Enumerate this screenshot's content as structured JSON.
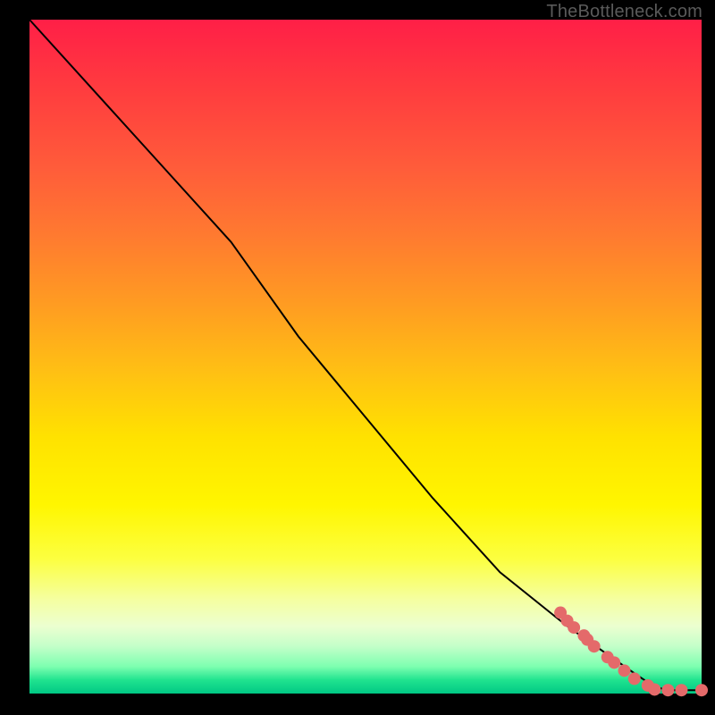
{
  "attribution": "TheBottleneck.com",
  "palette": {
    "line": "#000000",
    "marker": "#e46a6a",
    "marker_stroke": "#d85a5a"
  },
  "chart_data": {
    "type": "line",
    "title": "",
    "xlabel": "",
    "ylabel": "",
    "xlim": [
      0,
      100
    ],
    "ylim": [
      0,
      100
    ],
    "grid": false,
    "legend": false,
    "series": [
      {
        "name": "curve",
        "kind": "line",
        "x": [
          0,
          10,
          20,
          30,
          40,
          50,
          60,
          70,
          80,
          90,
          93,
          95,
          97,
          100
        ],
        "y": [
          100,
          89,
          78,
          67,
          53,
          41,
          29,
          18,
          10,
          3,
          1,
          0.5,
          0.5,
          0.5
        ]
      },
      {
        "name": "markers",
        "kind": "scatter",
        "x": [
          79,
          80,
          81,
          82.5,
          83,
          84,
          86,
          87,
          88.5,
          90,
          92,
          93,
          95,
          97,
          100
        ],
        "y": [
          12.0,
          10.8,
          9.8,
          8.6,
          8.0,
          7.0,
          5.4,
          4.6,
          3.4,
          2.2,
          1.2,
          0.6,
          0.5,
          0.5,
          0.5
        ]
      }
    ]
  }
}
